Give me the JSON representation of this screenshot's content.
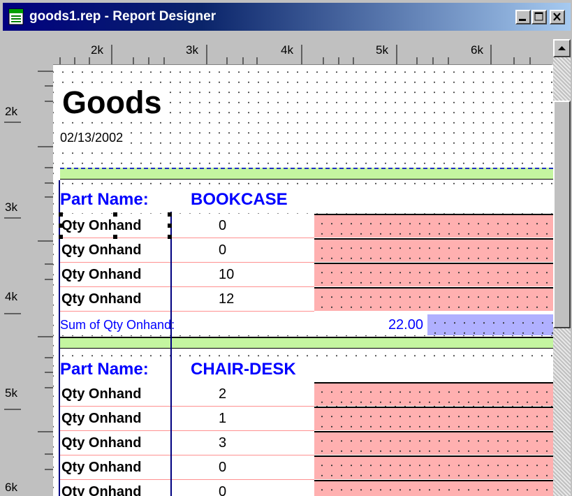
{
  "window": {
    "title": "goods1.rep - Report Designer",
    "controls": [
      "minimize",
      "maximize",
      "close"
    ]
  },
  "ruler": {
    "horizontal_labels": [
      "2k",
      "3k",
      "4k",
      "5k",
      "6k"
    ],
    "vertical_labels": [
      "2k",
      "3k",
      "4k",
      "5k",
      "6k"
    ]
  },
  "report": {
    "title": "Goods",
    "date": "02/13/2002",
    "groups": [
      {
        "part_label": "Part Name:",
        "part_value": "BOOKCASE",
        "rows": [
          {
            "label": "Qty Onhand",
            "value": "0"
          },
          {
            "label": "Qty Onhand",
            "value": "0"
          },
          {
            "label": "Qty Onhand",
            "value": "10"
          },
          {
            "label": "Qty Onhand",
            "value": "12"
          }
        ],
        "sum_label": "Sum of Qty Onhand:",
        "sum_value": "22.00"
      },
      {
        "part_label": "Part Name:",
        "part_value": "CHAIR-DESK",
        "rows": [
          {
            "label": "Qty Onhand",
            "value": "2"
          },
          {
            "label": "Qty Onhand",
            "value": "1"
          },
          {
            "label": "Qty Onhand",
            "value": "3"
          },
          {
            "label": "Qty Onhand",
            "value": "0"
          },
          {
            "label": "Qty Onhand",
            "value": "0"
          }
        ]
      }
    ]
  },
  "colors": {
    "title_bar": "#000080",
    "group_band": "#c4f5a0",
    "detail_fill": "#ffb0b0",
    "sum_fill": "#b0b0ff",
    "field_text": "#0000ff"
  }
}
